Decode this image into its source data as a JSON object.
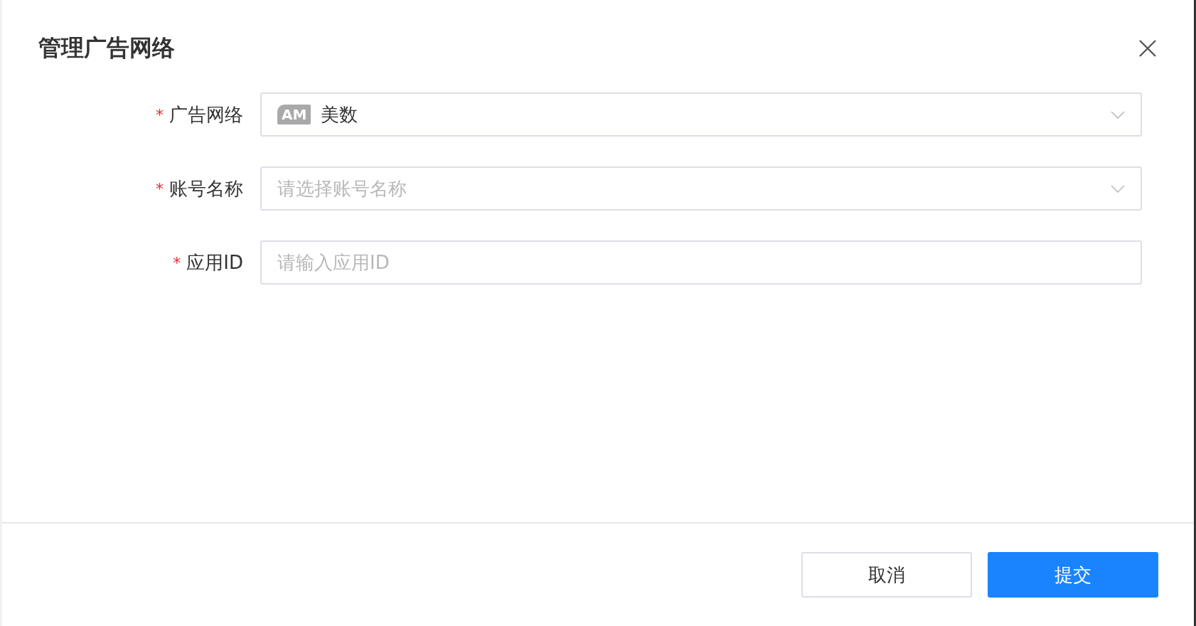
{
  "dialog": {
    "title": "管理广告网络"
  },
  "fields": [
    {
      "kind": "select",
      "label": "广告网络",
      "required": true,
      "logo_text": "AM",
      "value": "美数"
    },
    {
      "kind": "select",
      "label": "账号名称",
      "required": true,
      "placeholder": "请选择账号名称"
    },
    {
      "kind": "input",
      "label": "应用ID",
      "required": true,
      "placeholder": "请输入应用ID"
    }
  ],
  "required_mark": "*",
  "buttons": [
    {
      "label": "取消",
      "kind": "secondary"
    },
    {
      "label": "提交",
      "kind": "primary"
    }
  ]
}
